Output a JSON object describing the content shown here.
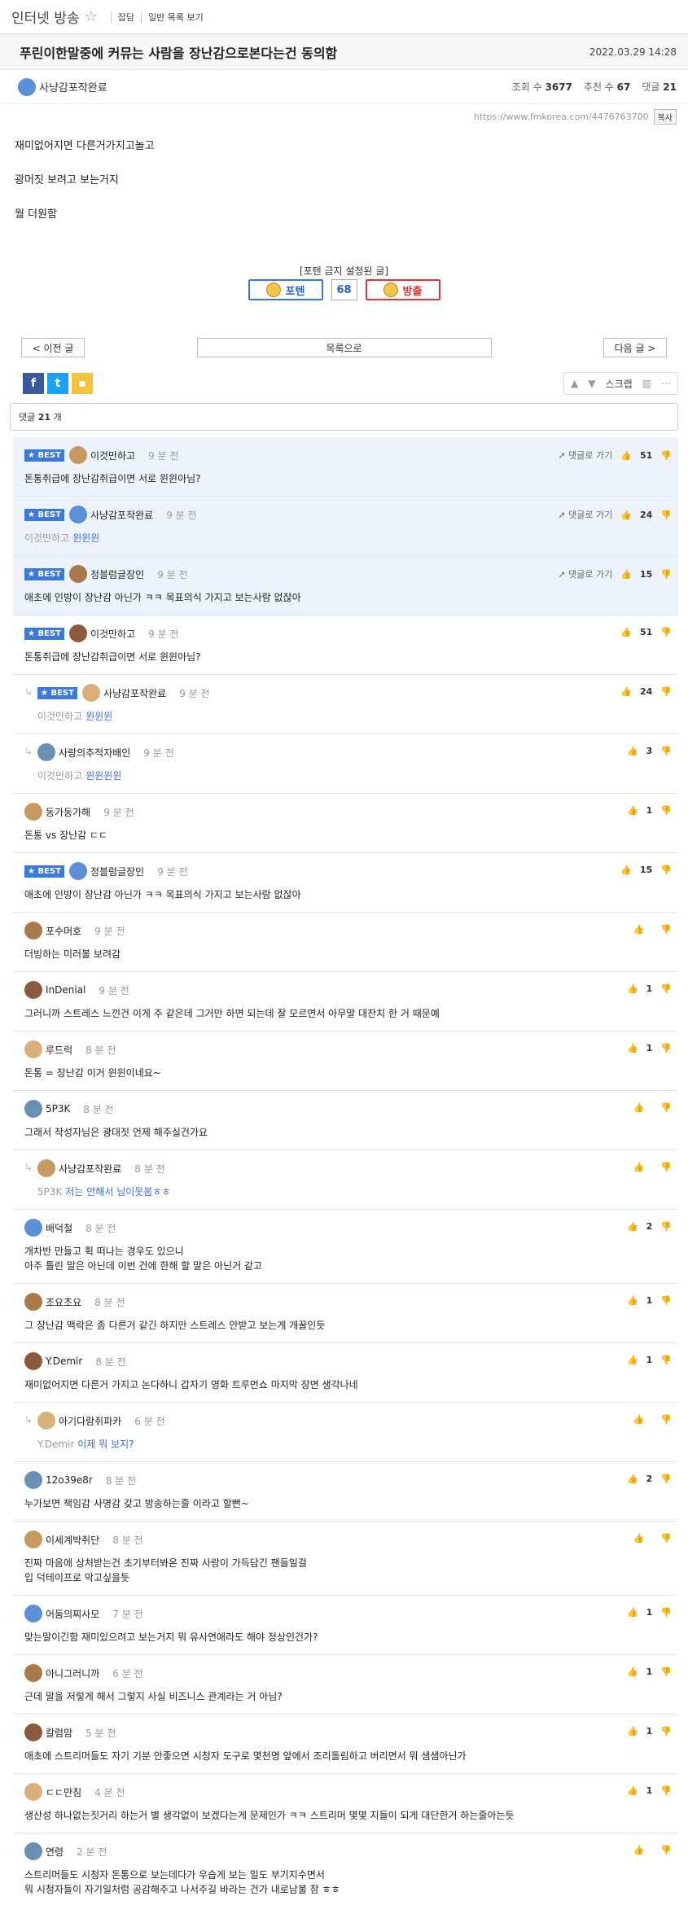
{
  "board": {
    "title": "인터넷 방송",
    "link1": "잡담",
    "link2": "일반 목록 보기"
  },
  "post": {
    "title": "푸린이한말중에 커뮤는 사람을 장난감으로본다는건 동의함",
    "date": "2022.03.29 14:28",
    "author": "사냥감포작완료",
    "views_label": "조회 수",
    "views": "3677",
    "votes_label": "추천 수",
    "votes": "67",
    "comments_label": "댓글",
    "comments": "21",
    "url": "https://www.fmkorea.com/4476763700",
    "copy": "복사",
    "lines": [
      "재미없어지면 다른거가지고놀고",
      "광머짓 보려고 보는거지",
      "뭘 더원함"
    ]
  },
  "potten": {
    "label": "[포텐 금지 설정된 글]",
    "up": "포텐",
    "count": "68",
    "down": "방출"
  },
  "nav": {
    "prev": "< 이전 글",
    "list": "목록으로",
    "next": "다음 글 >"
  },
  "tools": {
    "scrap": "스크랩"
  },
  "comment_header": {
    "prefix": "댓글",
    "count": "21",
    "suffix": "개"
  },
  "best_label": "BEST",
  "goto_label": "댓글로 가기",
  "comments": [
    {
      "nick": "이것만하고",
      "time": "9 분 전",
      "text": "돈통취급에 장난감취급이면 서로 윈윈아님?",
      "likes": "51",
      "best": true,
      "reply": false,
      "to": ""
    },
    {
      "nick": "사냥감포작완료",
      "time": "9 분 전",
      "text": "윈윈윈",
      "likes": "24",
      "best": true,
      "reply": false,
      "to": "이것만하고"
    },
    {
      "nick": "정블럼글장인",
      "time": "9 분 전",
      "text": "애초에 인방이 장난감 아닌가 ㅋㅋ 목표의식 가지고 보는사람 없잖아",
      "likes": "15",
      "best": true,
      "reply": false,
      "to": ""
    },
    {
      "nick": "이것만하고",
      "time": "9 분 전",
      "text": "돈통취급에 장난감취급이면 서로 윈윈아님?",
      "likes": "51",
      "best": true,
      "reply": false,
      "to": ""
    },
    {
      "nick": "사냥감포작완료",
      "time": "9 분 전",
      "text": "윈윈윈",
      "likes": "24",
      "best": true,
      "reply": true,
      "to": "이것만하고"
    },
    {
      "nick": "사랑의추적자배인",
      "time": "9 분 전",
      "text": "윈윈윈윈",
      "likes": "3",
      "best": false,
      "reply": true,
      "to": "이것만하고"
    },
    {
      "nick": "동가동가해",
      "time": "9 분 전",
      "text": "돈통 vs 장난감 ㄷㄷ",
      "likes": "1",
      "best": false,
      "reply": false,
      "to": ""
    },
    {
      "nick": "정블럼글장인",
      "time": "9 분 전",
      "text": "애초에 인방이 장난감 아닌가 ㅋㅋ 목표의식 가지고 보는사람 없잖아",
      "likes": "15",
      "best": true,
      "reply": false,
      "to": ""
    },
    {
      "nick": "포수머호",
      "time": "9 분 전",
      "text": "더빙하는 미러볼 보려감",
      "likes": "",
      "best": false,
      "reply": false,
      "to": ""
    },
    {
      "nick": "InDenial",
      "time": "9 분 전",
      "text": "그러니까 스트레스 느낀건 이게 주 같은데 그거만 하면 되는데 잘 모르면서 아무말 대잔치 한 거 때문예",
      "likes": "1",
      "best": false,
      "reply": false,
      "to": ""
    },
    {
      "nick": "루드럭",
      "time": "8 분 전",
      "text": "돈통 = 장난감 이거 윈윈이네요~",
      "likes": "1",
      "best": false,
      "reply": false,
      "to": ""
    },
    {
      "nick": "5P3K",
      "time": "8 분 전",
      "text": "그래서 작성자님은 광대짓 언제 해주실건가요",
      "likes": "",
      "best": false,
      "reply": false,
      "to": ""
    },
    {
      "nick": "사냥감포작완료",
      "time": "8 분 전",
      "text": "저는 안해서 님이못봄ㅎㅎ",
      "likes": "",
      "best": false,
      "reply": true,
      "to": "5P3K"
    },
    {
      "nick": "배덕철",
      "time": "8 분 전",
      "text": "개차반 만들고 휙 떠나는 경우도 있으니\n아주 틀린 말은 아닌데 이번 건에 한해 할 말은 아닌거 같고",
      "likes": "2",
      "best": false,
      "reply": false,
      "to": ""
    },
    {
      "nick": "조요조요",
      "time": "8 분 전",
      "text": "그 장난감 맥락은 좀 다른거 같긴 하지만 스트레스 안받고 보는게 개꿀인듯",
      "likes": "1",
      "best": false,
      "reply": false,
      "to": ""
    },
    {
      "nick": "Y.Demir",
      "time": "8 분 전",
      "text": "재미없어지면 다른거 가지고 논다하니 갑자기 영화 트루먼쇼 마지막 장면 생각나네",
      "likes": "1",
      "best": false,
      "reply": false,
      "to": ""
    },
    {
      "nick": "아기다람쥐파카",
      "time": "6 분 전",
      "text": "이제 뭐 보지?",
      "likes": "",
      "best": false,
      "reply": true,
      "to": "Y.Demir"
    },
    {
      "nick": "12o39e8r",
      "time": "8 분 전",
      "text": "누가보면 책임감 사명감 갖고 방송하는줄 이라고 할뻔~",
      "likes": "2",
      "best": false,
      "reply": false,
      "to": ""
    },
    {
      "nick": "이세계박쥐단",
      "time": "8 분 전",
      "text": "진짜 마음에 상처받는건 초기부터봐온 진짜 사랑이 가득담긴 팬들일걸\n입 덕테이프로 막고싶을듯",
      "likes": "",
      "best": false,
      "reply": false,
      "to": ""
    },
    {
      "nick": "어둠의찌사모",
      "time": "7 분 전",
      "text": "맞는말이긴함 재미있으려고 보는거지 뭐 유사연애라도 해야 정상인건가?",
      "likes": "1",
      "best": false,
      "reply": false,
      "to": ""
    },
    {
      "nick": "아니그러니까",
      "time": "6 분 전",
      "text": "근데 말을 저렇게 해서 그렇지 사실 비즈니스 관계라는 거 아님?",
      "likes": "1",
      "best": false,
      "reply": false,
      "to": ""
    },
    {
      "nick": "칼럼맘",
      "time": "5 분 전",
      "text": "애초에 스트리머들도 자기 기분 안좋으면 시청자 도구로 몇천명 앞에서 조리돌림하고 버리면서 뭐 샘샘아닌가",
      "likes": "1",
      "best": false,
      "reply": false,
      "to": ""
    },
    {
      "nick": "ㄷㄷ만침",
      "time": "4 분 전",
      "text": "생산성 하나없는짓거리 하는거 별 생각없이 보겠다는게 문제인가 ㅋㅋ 스트리머 몇몇 지들이 되게 대단한거 하는줄아는듯",
      "likes": "1",
      "best": false,
      "reply": false,
      "to": ""
    },
    {
      "nick": "연령",
      "time": "2 분 전",
      "text": "스트리머들도 시청자 돈통으로 보는데다가 우습게 보는 일도 부기지수면서\n뭐 시청자들이 자기일처럼 공감해주고 나서주길 바라는 건가 내로남불 참 ㅎㅎ",
      "likes": "",
      "best": false,
      "reply": false,
      "to": ""
    }
  ]
}
